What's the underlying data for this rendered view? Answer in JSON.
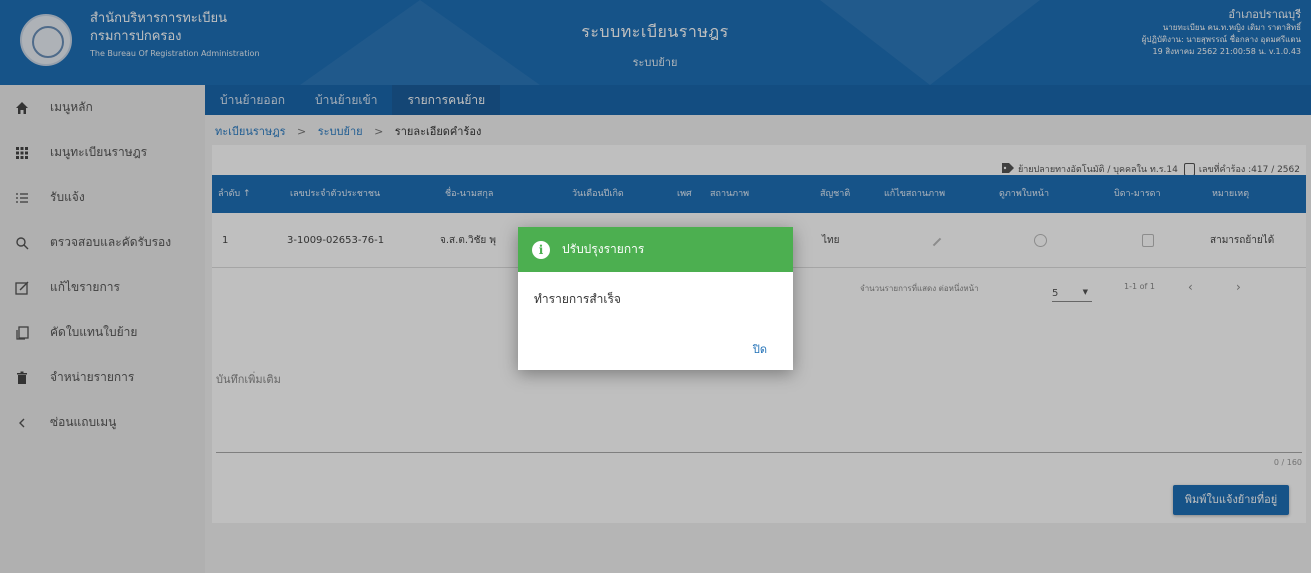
{
  "header": {
    "org_line1": "สำนักบริหารการทะเบียน",
    "org_line2": "กรมการปกครอง",
    "org_line3": "The Bureau Of Registration Administration",
    "system_title": "ระบบทะเบียนราษฎร",
    "system_subtitle": "ระบบย้าย",
    "user_office": "อำเภอปราณบุรี",
    "user_line2": "นายทะเบียน คน.ท.หญิง เดิมา ราตาสิทธิ์",
    "user_line3": "ผู้ปฏิบัติงาน: นายสุพรรณ์ ชื่อกลาง อุดมศรีแดน",
    "user_datetime": "19 สิงหาคม 2562 21:00:58 น.  v.1.0.43"
  },
  "sidebar": {
    "items": [
      {
        "label": "เมนูหลัก",
        "icon": "home-icon"
      },
      {
        "label": "เมนูทะเบียนราษฎร",
        "icon": "grid-icon"
      },
      {
        "label": "รับแจ้ง",
        "icon": "list-icon"
      },
      {
        "label": "ตรวจสอบและคัดรับรอง",
        "icon": "search-icon"
      },
      {
        "label": "แก้ไขรายการ",
        "icon": "edit-icon"
      },
      {
        "label": "คัดใบแทนใบย้าย",
        "icon": "copy-icon"
      },
      {
        "label": "จำหน่ายรายการ",
        "icon": "trash-icon"
      },
      {
        "label": "ซ่อนแถบเมนู",
        "icon": "chevron-left-icon"
      }
    ]
  },
  "tabs": [
    {
      "label": "บ้านย้ายออก"
    },
    {
      "label": "บ้านย้ายเข้า"
    },
    {
      "label": "รายการคนย้าย"
    }
  ],
  "breadcrumb": {
    "item1": "ทะเบียนราษฎร",
    "item2": "ระบบย้าย",
    "current": "รายละเอียดคำร้อง",
    "separator": ">"
  },
  "info": {
    "move_type": "ย้ายปลายทางอัตโนมัติ / บุคคลใน ท.ร.14",
    "request_no": "เลขที่คำร้อง :417 / 2562"
  },
  "table": {
    "headers": [
      "ลำดับ ↑",
      "เลขประจำตัวประชาชน",
      "ชื่อ-นามสกุล",
      "วันเดือนปีเกิด",
      "เพศ",
      "สถานภาพ",
      "สัญชาติ",
      "แก้ไขสถานภาพ",
      "ดูภาพใบหน้า",
      "บิดา-มารดา",
      "หมายเหตุ"
    ],
    "row": {
      "index": "1",
      "id_number": "3-1009-02653-76-1",
      "name": "จ.ส.ต.วิชัย พุ",
      "nationality": "ไทย",
      "note": "สามารถย้ายได้"
    }
  },
  "pager": {
    "rows_label": "จำนวนรายการที่แสดง ต่อหนึ่งหน้า",
    "rows_value": "5",
    "range": "1-1 of 1",
    "prev": "‹",
    "next": "›"
  },
  "remark": {
    "label": "บันทึกเพิ่มเติม",
    "counter": "0 / 160"
  },
  "print_button": "พิมพ์ใบแจ้งย้ายที่อยู่",
  "dialog": {
    "title": "ปรับปรุงรายการ",
    "message": "ทำรายการสำเร็จ",
    "close_label": "ปิด",
    "info_glyph": "i"
  }
}
